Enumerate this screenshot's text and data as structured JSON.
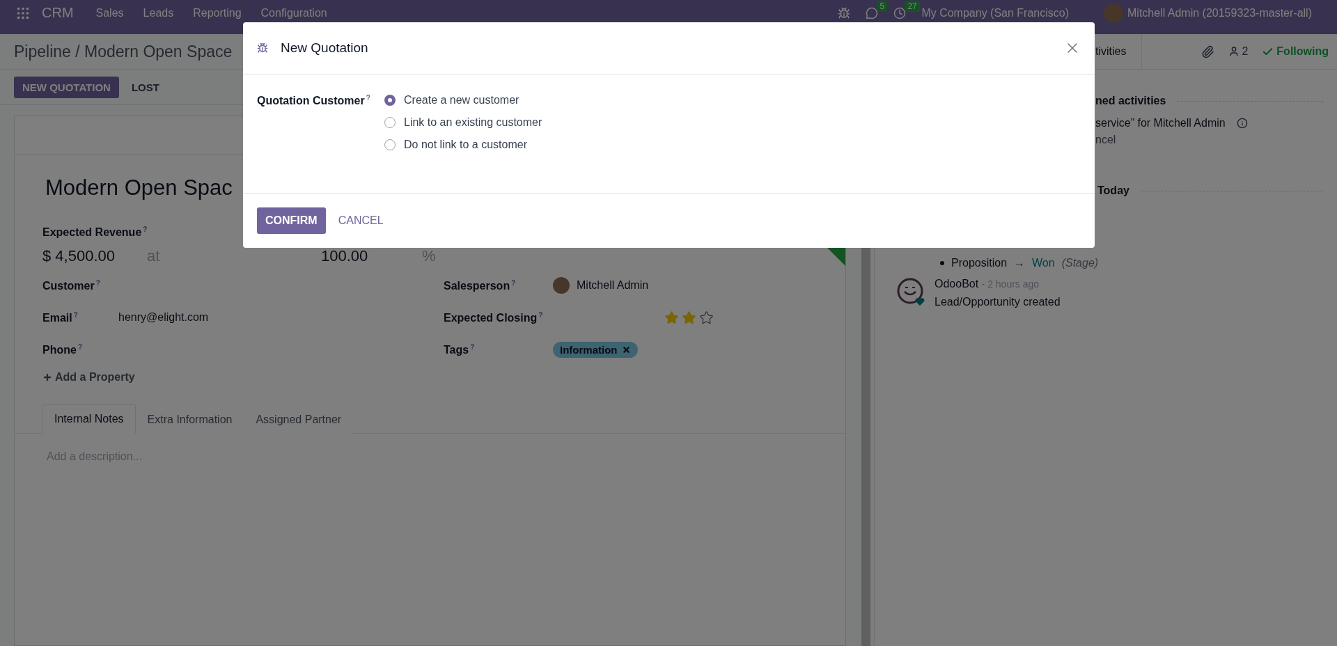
{
  "navbar": {
    "app": "CRM",
    "menu": [
      "Sales",
      "Leads",
      "Reporting",
      "Configuration"
    ],
    "messages_count": "5",
    "activities_count": "27",
    "company": "My Company (San Francisco)",
    "user": "Mitchell Admin (20159323-master-all)"
  },
  "breadcrumb": "Pipeline / Modern Open Space",
  "actions": [
    {
      "label": "NEW QUOTATION",
      "kind": "primary"
    },
    {
      "label": "LOST",
      "kind": "secondary"
    }
  ],
  "form": {
    "title": "Modern Open Spac",
    "revenue_label": "Expected Revenue$^{?}$",
    "revenue": "$ 4,500.00",
    "at": "at",
    "probability": "100.00",
    "percent": "%",
    "left_fields": [
      {
        "label": "Customer$^{?}$"
      },
      {
        "label": "Email$^{?}$",
        "value": "henry@elight.com"
      },
      {
        "label": "Phone$^{?}$"
      }
    ],
    "salesperson_label": "Salesperson$^{?}$",
    "salesperson": "Mitchell Admin",
    "closing_label": "Expected Closing$^{?}$",
    "stars": 2,
    "tags_label": "Tags$^{?}$",
    "tags": [
      "Information"
    ],
    "add_property": "Add a Property",
    "tabs": [
      {
        "label": "Internal Notes",
        "selected": true
      },
      {
        "label": "Extra Information",
        "selected": false
      },
      {
        "label": "Assigned Partner",
        "selected": false
      }
    ],
    "description_placeholder": "Add a description..."
  },
  "chatter": {
    "activities_partial": "tivities",
    "followers": "2",
    "following": "Following",
    "planned_header": "ned activities",
    "activity_text": "service”  for Mitchell Admin",
    "activity_link": "ncel",
    "date_header": "Today",
    "tracking": {
      "from": "Proposition",
      "arrow": "→",
      "to": "Won",
      "field": "(Stage)"
    },
    "message": {
      "author": "OdooBot",
      "time": "- 2 hours ago",
      "body": "Lead/Opportunity created"
    }
  },
  "dialog": {
    "title": "New Quotation",
    "field_label": "Quotation Customer$^{?}$",
    "options": [
      {
        "label": "Create a new customer",
        "selected": true
      },
      {
        "label": "Link to an existing customer",
        "selected": false
      },
      {
        "label": "Do not link to a customer",
        "selected": false
      }
    ],
    "buttons": [
      {
        "label": "CONFIRM",
        "kind": "primary"
      },
      {
        "label": "CANCEL",
        "kind": "link"
      }
    ]
  }
}
